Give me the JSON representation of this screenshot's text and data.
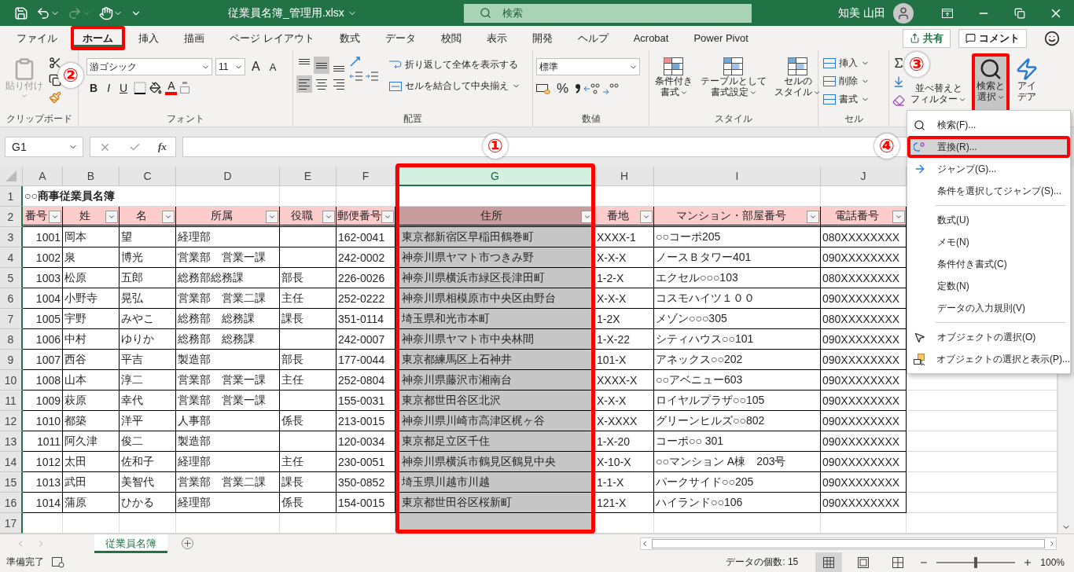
{
  "title_bar": {
    "file_name": "従業員名簿_管理用.xlsx",
    "search_placeholder": "検索",
    "user_name": "知美 山田"
  },
  "menu_tabs": [
    {
      "label": "ファイル",
      "selected": false,
      "outlined": false
    },
    {
      "label": "ホーム",
      "selected": true,
      "outlined": true
    },
    {
      "label": "挿入",
      "selected": false,
      "outlined": false
    },
    {
      "label": "描画",
      "selected": false,
      "outlined": false
    },
    {
      "label": "ページ レイアウト",
      "selected": false,
      "outlined": false
    },
    {
      "label": "数式",
      "selected": false,
      "outlined": false
    },
    {
      "label": "データ",
      "selected": false,
      "outlined": false
    },
    {
      "label": "校閲",
      "selected": false,
      "outlined": false
    },
    {
      "label": "表示",
      "selected": false,
      "outlined": false
    },
    {
      "label": "開発",
      "selected": false,
      "outlined": false
    },
    {
      "label": "ヘルプ",
      "selected": false,
      "outlined": false
    },
    {
      "label": "Acrobat",
      "selected": false,
      "outlined": false
    },
    {
      "label": "Power Pivot",
      "selected": false,
      "outlined": false
    }
  ],
  "share_button": "共有",
  "comment_button": "コメント",
  "ribbon": {
    "clipboard": {
      "paste": "貼り付け",
      "label": "クリップボード"
    },
    "font": {
      "font_name": "游ゴシック",
      "font_size": "11",
      "grow": "A",
      "shrink": "A",
      "bold": "B",
      "italic": "I",
      "underline": "U",
      "font_color": "A",
      "label": "フォント"
    },
    "alignment": {
      "vertical": [
        {
          "selected": false
        },
        {
          "selected": true
        },
        {
          "selected": false
        }
      ],
      "horizontal": [
        {
          "selected": true
        },
        {
          "selected": false
        },
        {
          "selected": false
        }
      ],
      "wrap_text": "折り返して全体を表示する",
      "merge": "セルを結合して中央揃え",
      "label": "配置"
    },
    "number": {
      "format": "標準",
      "percent": "%",
      "label": "数値"
    },
    "styles": {
      "buttons": [
        {
          "lines": [
            "条件付き",
            "書式"
          ]
        },
        {
          "lines": [
            "テーブルとして",
            "書式設定"
          ]
        },
        {
          "lines": [
            "セルの",
            "スタイル"
          ]
        }
      ],
      "label": "スタイル"
    },
    "cells": {
      "buttons": [
        "挿入",
        "削除",
        "書式"
      ],
      "label": "セル"
    },
    "editing": {
      "sort": [
        "並べ替えと",
        "フィルター"
      ],
      "find": {
        "lines": [
          "検索と",
          "選択"
        ],
        "selected": true,
        "outlined": true
      },
      "ideas": [
        "アイ",
        "デア"
      ]
    }
  },
  "formula_bar": {
    "name_box": "G1",
    "fx": "fx"
  },
  "sheet": {
    "columns": [
      {
        "letter": "A",
        "selected": false,
        "outlined": false
      },
      {
        "letter": "B",
        "selected": false,
        "outlined": false
      },
      {
        "letter": "C",
        "selected": false,
        "outlined": false
      },
      {
        "letter": "D",
        "selected": false,
        "outlined": false
      },
      {
        "letter": "E",
        "selected": false,
        "outlined": false
      },
      {
        "letter": "F",
        "selected": false,
        "outlined": false
      },
      {
        "letter": "G",
        "selected": true,
        "outlined": true
      },
      {
        "letter": "H",
        "selected": false,
        "outlined": false
      },
      {
        "letter": "I",
        "selected": false,
        "outlined": false
      },
      {
        "letter": "J",
        "selected": false,
        "outlined": false
      }
    ],
    "title_row": {
      "number": "1",
      "text": "○○商事従業員名簿"
    },
    "header_row": {
      "number": "2",
      "cells": [
        "番号",
        "姓",
        "名",
        "所属",
        "役職",
        "郵便番号",
        "住所",
        "番地",
        "マンション・部屋番号",
        "電話番号"
      ]
    },
    "rows": [
      {
        "number": "3",
        "id": "1001",
        "surname": "岡本",
        "given_name": "望",
        "department": "経理部",
        "postal_code": "162-0041",
        "address": "東京都新宿区早稲田鶴巻町",
        "lot": "XXXX-1",
        "building": "○○コーポ205",
        "phone": "080XXXXXXXX"
      },
      {
        "number": "4",
        "id": "1002",
        "surname": "泉",
        "given_name": "博光",
        "department": "営業部　営業一課",
        "postal_code": "242-0002",
        "address": "神奈川県ヤマト市つきみ野",
        "lot": "X-X-X",
        "building": "ノースＢタワー401",
        "phone": "090XXXXXXXX"
      },
      {
        "number": "5",
        "id": "1003",
        "surname": "松原",
        "given_name": "五郎",
        "department": "総務部総務課",
        "title": "部長",
        "postal_code": "226-0026",
        "address": "神奈川県横浜市緑区長津田町",
        "lot": "1-2-X",
        "building": "エクセル○○○103",
        "phone": "080XXXXXXXX"
      },
      {
        "number": "6",
        "id": "1004",
        "surname": "小野寺",
        "given_name": "晃弘",
        "department": "営業部　営業二課",
        "title": "主任",
        "postal_code": "252-0222",
        "address": "神奈川県相模原市中央区由野台",
        "lot": "X-X-X",
        "building": "コスモハイツ１００",
        "phone": "090XXXXXXXX"
      },
      {
        "number": "7",
        "id": "1005",
        "surname": "宇野",
        "given_name": "みやこ",
        "department": "総務部　総務課",
        "title": "課長",
        "postal_code": "351-0114",
        "address": "埼玉県和光市本町",
        "lot": "1-2X",
        "building": "メゾン○○○305",
        "phone": "080XXXXXXXX"
      },
      {
        "number": "8",
        "id": "1006",
        "surname": "中村",
        "given_name": "ゆりか",
        "department": "総務部　総務課",
        "postal_code": "242-0007",
        "address": "神奈川県ヤマト市中央林間",
        "lot": "1-X-22",
        "building": "シティハウス○○101",
        "phone": "090XXXXXXXX"
      },
      {
        "number": "9",
        "id": "1007",
        "surname": "西谷",
        "given_name": "平吉",
        "department": "製造部",
        "title": "部長",
        "postal_code": "177-0044",
        "address": "東京都練馬区上石神井",
        "lot": "101-X",
        "building": "アネックス○○202",
        "phone": "090XXXXXXXX"
      },
      {
        "number": "10",
        "id": "1008",
        "surname": "山本",
        "given_name": "淳二",
        "department": "営業部　営業一課",
        "title": "主任",
        "postal_code": "252-0804",
        "address": "神奈川県藤沢市湘南台",
        "lot": "XXXX-X",
        "building": "○○アベニュー603",
        "phone": "090XXXXXXXX"
      },
      {
        "number": "11",
        "id": "1009",
        "surname": "萩原",
        "given_name": "幸代",
        "department": "営業部　営業一課",
        "postal_code": "155-0031",
        "address": "東京都世田谷区北沢",
        "lot": "X-X-X",
        "building": "ロイヤルプラザ○○105",
        "phone": "090XXXXXXXX"
      },
      {
        "number": "12",
        "id": "1010",
        "surname": "都築",
        "given_name": "洋平",
        "department": "人事部",
        "title": "係長",
        "postal_code": "213-0015",
        "address": "神奈川県川崎市高津区梶ヶ谷",
        "lot": "X-XXXX",
        "building": "グリーンヒルズ○○802",
        "phone": "090XXXXXXXX"
      },
      {
        "number": "13",
        "id": "1011",
        "surname": "阿久津",
        "given_name": "俊二",
        "department": "製造部",
        "postal_code": "120-0034",
        "address": "東京都足立区千住",
        "lot": "1-X-20",
        "building": "コーポ○○ 301",
        "phone": "090XXXXXXXX"
      },
      {
        "number": "14",
        "id": "1012",
        "surname": "太田",
        "given_name": "佐和子",
        "department": "経理部",
        "title": "主任",
        "postal_code": "230-0051",
        "address": "神奈川県横浜市鶴見区鶴見中央",
        "lot": "X-10-X",
        "building": "○○マンション A棟　203号",
        "phone": "090XXXXXXXX"
      },
      {
        "number": "15",
        "id": "1013",
        "surname": "武田",
        "given_name": "美智代",
        "department": "営業部　営業二課",
        "title": "課長",
        "postal_code": "350-0852",
        "address": "埼玉県川越市川越",
        "lot": "1-1-X",
        "building": "パークサイド○○205",
        "phone": "090XXXXXXXX"
      },
      {
        "number": "16",
        "id": "1014",
        "surname": "蒲原",
        "given_name": "ひかる",
        "department": "経理部",
        "title": "係長",
        "postal_code": "154-0015",
        "address": "東京都世田谷区桜新町",
        "lot": "121-X",
        "building": "ハイランド○○106",
        "phone": "090XXXXXXXX"
      }
    ],
    "empty_rows": [
      "17"
    ]
  },
  "dropdown_menu": [
    {
      "kind": "item",
      "label": "検索(F)...",
      "selected": false,
      "outlined": false
    },
    {
      "kind": "item",
      "label": "置換(R)...",
      "selected": true,
      "outlined": true
    },
    {
      "kind": "item",
      "label": "ジャンプ(G)...",
      "selected": false,
      "outlined": false
    },
    {
      "kind": "item",
      "label": "条件を選択してジャンプ(S)...",
      "selected": false,
      "outlined": false
    },
    {
      "kind": "separator"
    },
    {
      "kind": "item",
      "label": "数式(U)",
      "selected": false,
      "outlined": false
    },
    {
      "kind": "item",
      "label": "メモ(N)",
      "selected": false,
      "outlined": false
    },
    {
      "kind": "item",
      "label": "条件付き書式(C)",
      "selected": false,
      "outlined": false
    },
    {
      "kind": "item",
      "label": "定数(N)",
      "selected": false,
      "outlined": false
    },
    {
      "kind": "item",
      "label": "データの入力規則(V)",
      "selected": false,
      "outlined": false
    },
    {
      "kind": "separator"
    },
    {
      "kind": "item",
      "label": "オブジェクトの選択(O)",
      "selected": false,
      "outlined": false
    },
    {
      "kind": "item",
      "label": "オブジェクトの選択と表示(P)...",
      "selected": false,
      "outlined": false
    }
  ],
  "sheet_tabs": [
    {
      "label": "従業員名簿",
      "selected": true
    }
  ],
  "status_bar": {
    "status": "準備完了",
    "count": "データの個数: 15",
    "views": [
      {
        "selected": true
      },
      {
        "selected": false
      },
      {
        "selected": false
      }
    ],
    "zoom": {
      "level": 0.5
    },
    "zoom_text": "100%"
  },
  "callouts": [
    "①",
    "②",
    "③",
    "④"
  ]
}
